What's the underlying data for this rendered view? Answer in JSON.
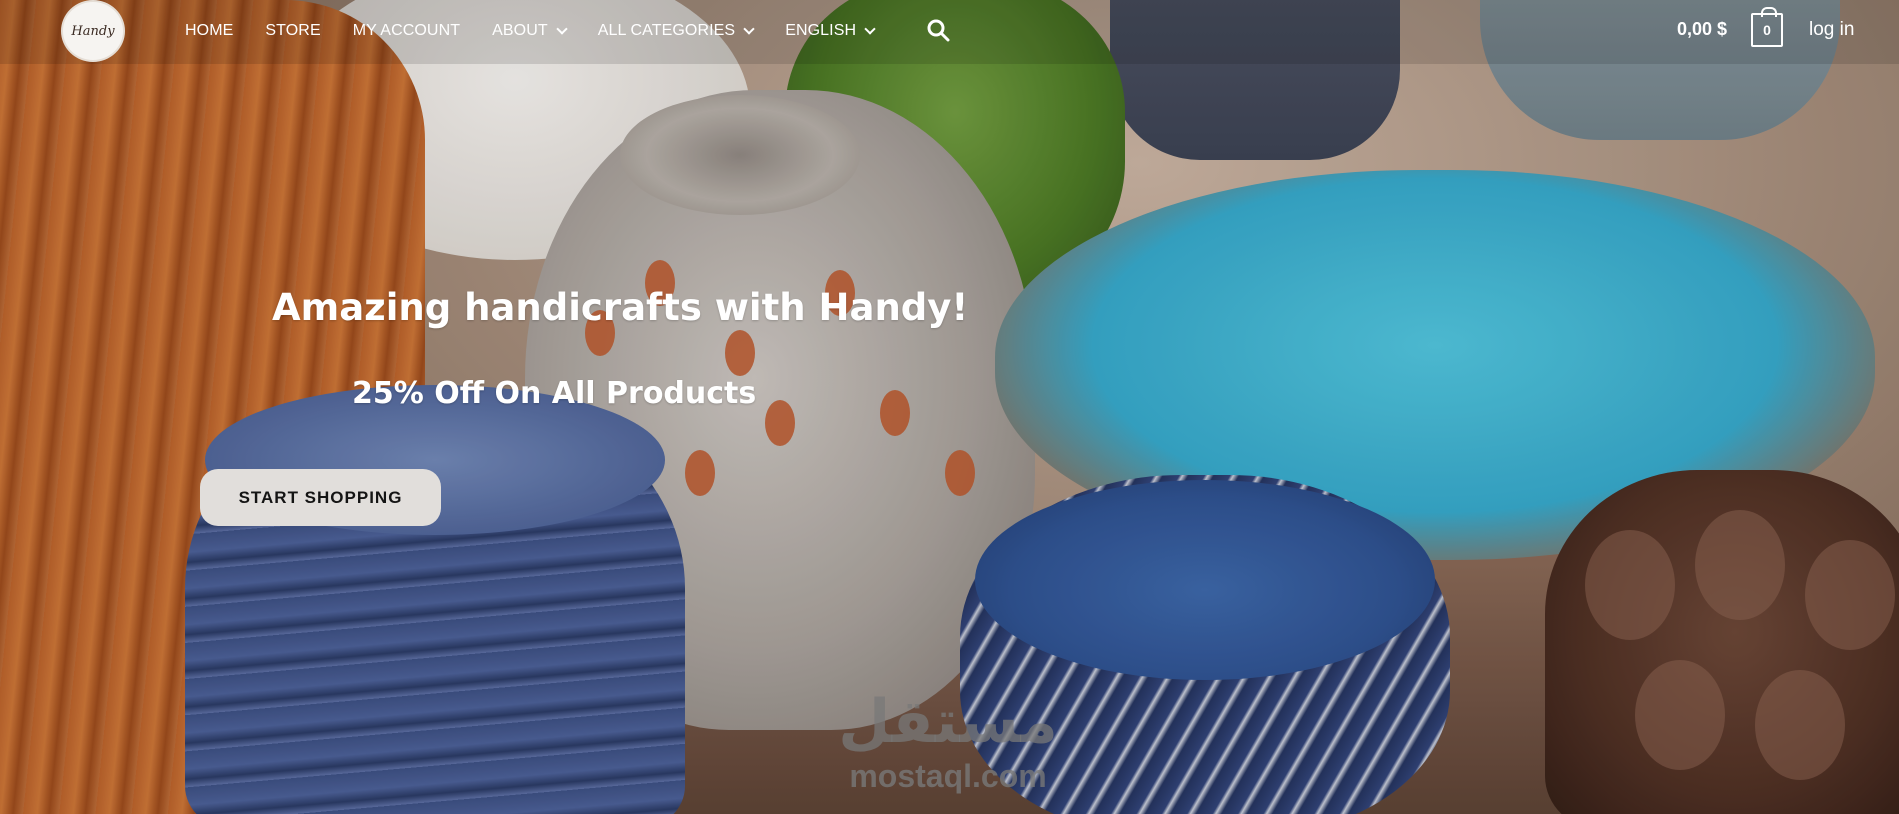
{
  "brand": {
    "logo_text": "Handy"
  },
  "nav": {
    "items": [
      {
        "label": "HOME"
      },
      {
        "label": "STORE"
      },
      {
        "label": "MY ACCOUNT"
      },
      {
        "label": "ABOUT"
      },
      {
        "label": "ALL CATEGORIES"
      },
      {
        "label": "ENGLISH"
      }
    ]
  },
  "header": {
    "cart_total": "0,00 $",
    "cart_count": "0",
    "login_label": "log in",
    "search_icon": "search-icon",
    "cart_icon": "shopping-bag-icon"
  },
  "hero": {
    "title": "Amazing handicrafts with Handy!",
    "subtitle": "25% Off On All Products",
    "cta_label": "START SHOPPING"
  },
  "watermark": {
    "arabic": "مستقل",
    "english": "mostaql.com"
  },
  "colors": {
    "header_text": "#ffffff",
    "cta_bg": "#e1dedb",
    "cta_text": "#141414"
  }
}
